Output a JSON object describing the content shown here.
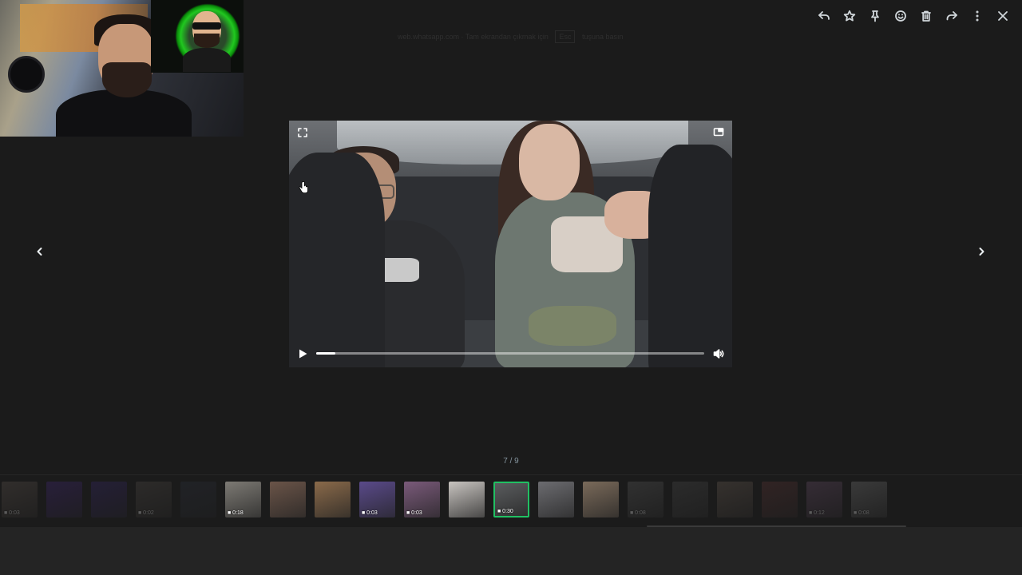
{
  "header": {
    "faded_text_left": "web.whatsapp.com · Tam ekrandan çıkmak için",
    "faded_key": "Esc",
    "faded_text_right": "tuşuna basın"
  },
  "toolbar": {
    "icons": [
      "reply-icon",
      "star-icon",
      "pin-icon",
      "emoji-icon",
      "delete-icon",
      "forward-icon",
      "more-options-icon",
      "close-icon"
    ]
  },
  "viewer": {
    "counter": "7 / 9",
    "video_progress_fraction": 0.05
  },
  "thumbnails": [
    {
      "duration": "0:03",
      "style": "dim",
      "bg": "#6b5f58"
    },
    {
      "duration": "",
      "style": "dim",
      "bg": "#4a2a8a"
    },
    {
      "duration": "",
      "style": "dim",
      "bg": "#3c2a7a"
    },
    {
      "duration": "0:02",
      "style": "dim",
      "bg": "#5b5550"
    },
    {
      "duration": "",
      "style": "dim",
      "bg": "#2f3442"
    },
    {
      "duration": "0:18",
      "style": "normal",
      "bg": "#7d7a74"
    },
    {
      "duration": "",
      "style": "normal",
      "bg": "#6a5448"
    },
    {
      "duration": "",
      "style": "normal",
      "bg": "#8a6a4a"
    },
    {
      "duration": "0:03",
      "style": "normal",
      "bg": "#5a4a8a"
    },
    {
      "duration": "0:03",
      "style": "normal",
      "bg": "#7a5a7a"
    },
    {
      "duration": "",
      "style": "normal",
      "bg": "#c8c4c0"
    },
    {
      "duration": "0:30",
      "style": "active",
      "bg": "#5a5c5e"
    },
    {
      "duration": "",
      "style": "normal",
      "bg": "#6c6c70"
    },
    {
      "duration": "",
      "style": "normal",
      "bg": "#7a6a5a"
    },
    {
      "duration": "0:08",
      "style": "dim",
      "bg": "#6a6a6a"
    },
    {
      "duration": "",
      "style": "dim",
      "bg": "#555555"
    },
    {
      "duration": "",
      "style": "dim",
      "bg": "#7a6a5e"
    },
    {
      "duration": "",
      "style": "dim",
      "bg": "#6a3a3a"
    },
    {
      "duration": "0:12",
      "style": "dim",
      "bg": "#7a5a7a"
    },
    {
      "duration": "0:08",
      "style": "dim",
      "bg": "#8a8a8a"
    }
  ]
}
